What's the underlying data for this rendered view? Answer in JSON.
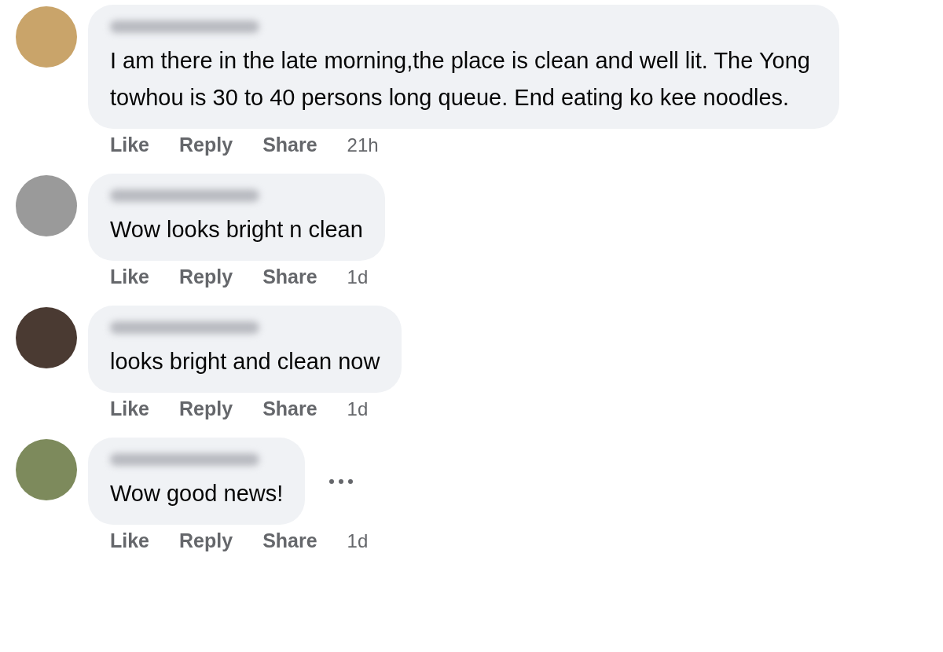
{
  "comments": [
    {
      "color": "#c9a46a",
      "text": "I am there in the late morning,the place is clean and well lit. The Yong towhou is 30 to 40 persons long queue. End eating ko kee noodles.",
      "actions": [
        "Like",
        "Reply",
        "Share"
      ],
      "time": "21h",
      "menu_shown": false
    },
    {
      "color": "#9a9a9a",
      "text": "Wow looks bright n clean",
      "actions": [
        "Like",
        "Reply",
        "Share"
      ],
      "time": "1d",
      "menu_shown": false
    },
    {
      "color": "#4a3a32",
      "text": "looks bright and clean now",
      "actions": [
        "Like",
        "Reply",
        "Share"
      ],
      "time": "1d",
      "menu_shown": false
    },
    {
      "color": "#7d8a5c",
      "text": "Wow good news!",
      "actions": [
        "Like",
        "Reply",
        "Share"
      ],
      "time": "1d",
      "menu_shown": true
    }
  ]
}
